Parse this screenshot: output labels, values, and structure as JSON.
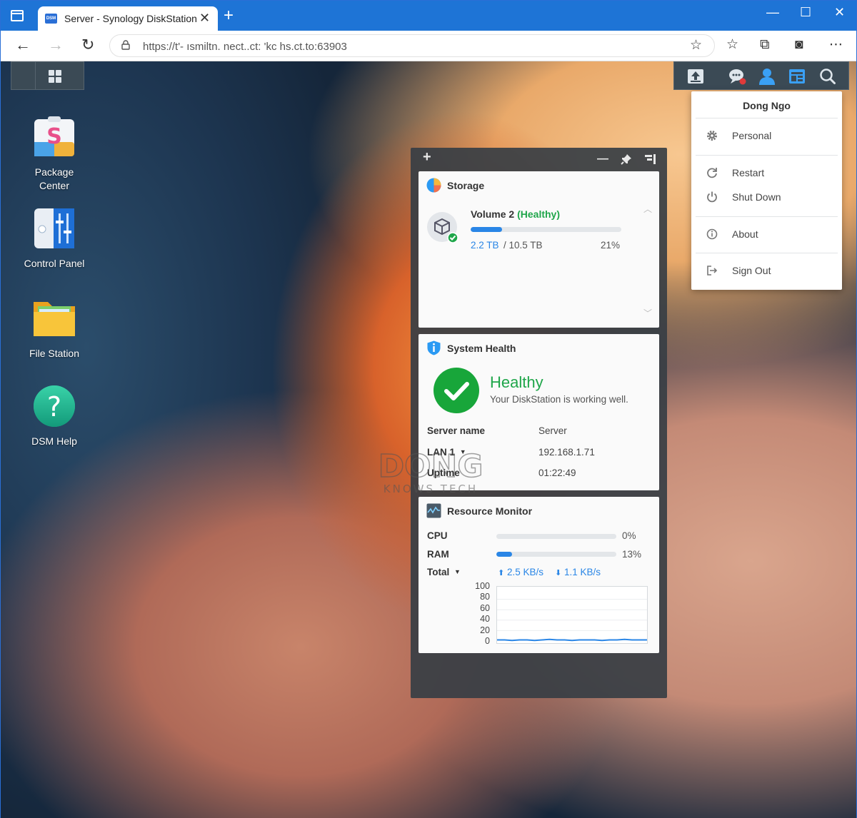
{
  "browser": {
    "tab_title": "Server - Synology DiskStation",
    "tab_favicon_text": "DSM",
    "url": "https://t'- ısmiltn.  nect..ct: 'kc  h⁣s.ct.to:63903"
  },
  "desktop": {
    "apps": [
      {
        "label": "Package\nCenter",
        "icon": "package-center-icon"
      },
      {
        "label": "Control Panel",
        "icon": "control-panel-icon"
      },
      {
        "label": "File Station",
        "icon": "file-station-icon"
      },
      {
        "label": "DSM Help",
        "icon": "dsm-help-icon"
      }
    ]
  },
  "widgets": {
    "storage": {
      "title": "Storage",
      "volume_name": "Volume 2",
      "volume_status": "(Healthy)",
      "used": "2.2 TB",
      "total": "/ 10.5 TB",
      "percent_text": "21%",
      "percent": 0.21
    },
    "system_health": {
      "title": "System Health",
      "status": "Healthy",
      "message": "Your DiskStation is working well.",
      "rows": [
        {
          "label": "Server name",
          "value": "Server"
        },
        {
          "label": "LAN 1",
          "value": "192.168.1.71"
        },
        {
          "label": "Uptime",
          "value": "01:22:49"
        }
      ]
    },
    "resource_monitor": {
      "title": "Resource Monitor",
      "cpu_label": "CPU",
      "cpu_pct_text": "0%",
      "cpu_pct": 0.0,
      "ram_label": "RAM",
      "ram_pct_text": "13%",
      "ram_pct": 0.13,
      "total_label": "Total",
      "upload": "2.5 KB/s",
      "download": "1.1 KB/s"
    }
  },
  "user_menu": {
    "user_name": "Dong Ngo",
    "items": [
      {
        "label": "Personal",
        "icon": "gear-icon"
      },
      {
        "label": "Restart",
        "icon": "restart-icon"
      },
      {
        "label": "Shut Down",
        "icon": "power-icon"
      },
      {
        "label": "About",
        "icon": "info-icon"
      },
      {
        "label": "Sign Out",
        "icon": "sign-out-icon"
      }
    ]
  },
  "watermark": {
    "line1": "DONG",
    "line2": "KNOWS TECH"
  },
  "chart_data": {
    "type": "line",
    "y_ticks": [
      "100",
      "80",
      "60",
      "40",
      "20",
      "0"
    ],
    "ylim": [
      0,
      100
    ],
    "series": [
      {
        "values": [
          2,
          2,
          1,
          2,
          2,
          1,
          2,
          3,
          2,
          2,
          1,
          2,
          2,
          2,
          1,
          2,
          2,
          3,
          2,
          2,
          2
        ]
      }
    ]
  }
}
